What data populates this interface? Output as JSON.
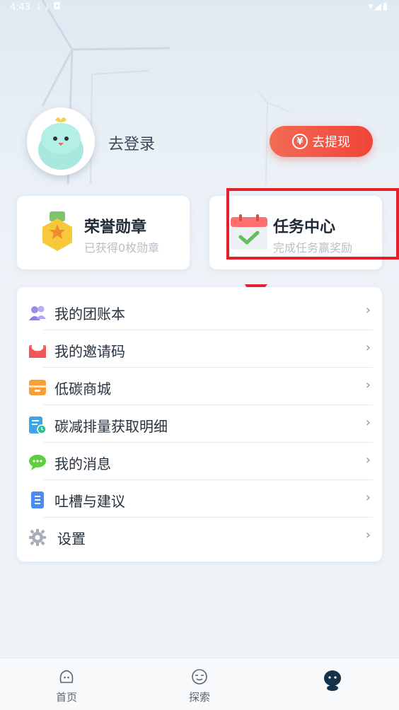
{
  "status_bar": {
    "time": "4:43",
    "left_icons": "⤓⤓◘",
    "right_icons": "▾◢▮"
  },
  "profile": {
    "login_label": "去登录",
    "withdraw": {
      "icon_text": "¥",
      "label": "去提现"
    }
  },
  "cards": [
    {
      "title": "荣誉勋章",
      "subtitle": "已获得0枚勋章"
    },
    {
      "title": "任务中心",
      "subtitle": "完成任务赢奖励"
    }
  ],
  "menu": {
    "items": [
      {
        "label": "我的团账本",
        "icon": "team-ledger-icon"
      },
      {
        "label": "我的邀请码",
        "icon": "invite-code-icon"
      },
      {
        "label": "低碳商城",
        "icon": "mall-icon"
      },
      {
        "label": "碳减排量获取明细",
        "icon": "carbon-detail-icon"
      },
      {
        "label": "我的消息",
        "icon": "message-icon"
      },
      {
        "label": "吐槽与建议",
        "icon": "feedback-icon"
      },
      {
        "label": "设置",
        "icon": "settings-icon"
      }
    ],
    "chevron": "›"
  },
  "bottom_nav": {
    "items": [
      {
        "label": "首页",
        "icon": "home-face-icon"
      },
      {
        "label": "探索",
        "icon": "explore-face-icon"
      },
      {
        "label": "",
        "icon": "profile-mascot-icon"
      }
    ]
  }
}
